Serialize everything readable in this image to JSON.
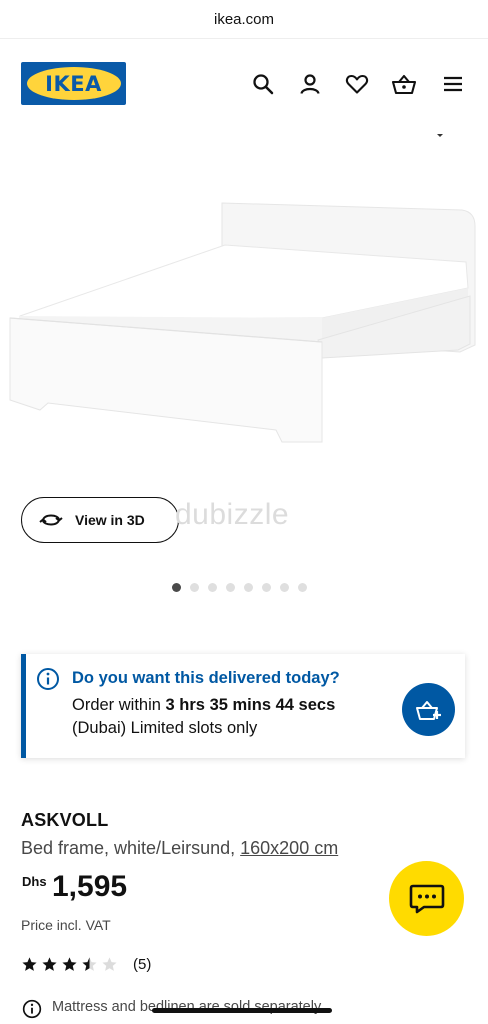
{
  "browser": {
    "url": "ikea.com"
  },
  "header": {
    "logo_text": "IKEA",
    "icons": [
      "search-icon",
      "user-icon",
      "heart-icon",
      "basket-icon",
      "menu-icon"
    ],
    "brand_blue": "#0058a3",
    "brand_yellow": "#ffdb00"
  },
  "gallery": {
    "view3d_label": "View in 3D",
    "watermark": "dubizzle",
    "dots_total": 8,
    "active_dot": 0
  },
  "delivery": {
    "title": "Do you want this delivered today?",
    "prefix": "Order within",
    "countdown": "3 hrs 35 mins 44 secs",
    "suffix": "(Dubai) Limited slots only"
  },
  "product": {
    "name": "ASKVOLL",
    "description": "Bed frame, white/Leirsund,",
    "size": "160x200 cm",
    "currency": "Dhs",
    "price": "1,595",
    "price_note": "Price incl. VAT",
    "rating": 3.5,
    "rating_max": 5,
    "reviews": "(5)",
    "note": "Mattress and bedlinen are sold separately."
  }
}
